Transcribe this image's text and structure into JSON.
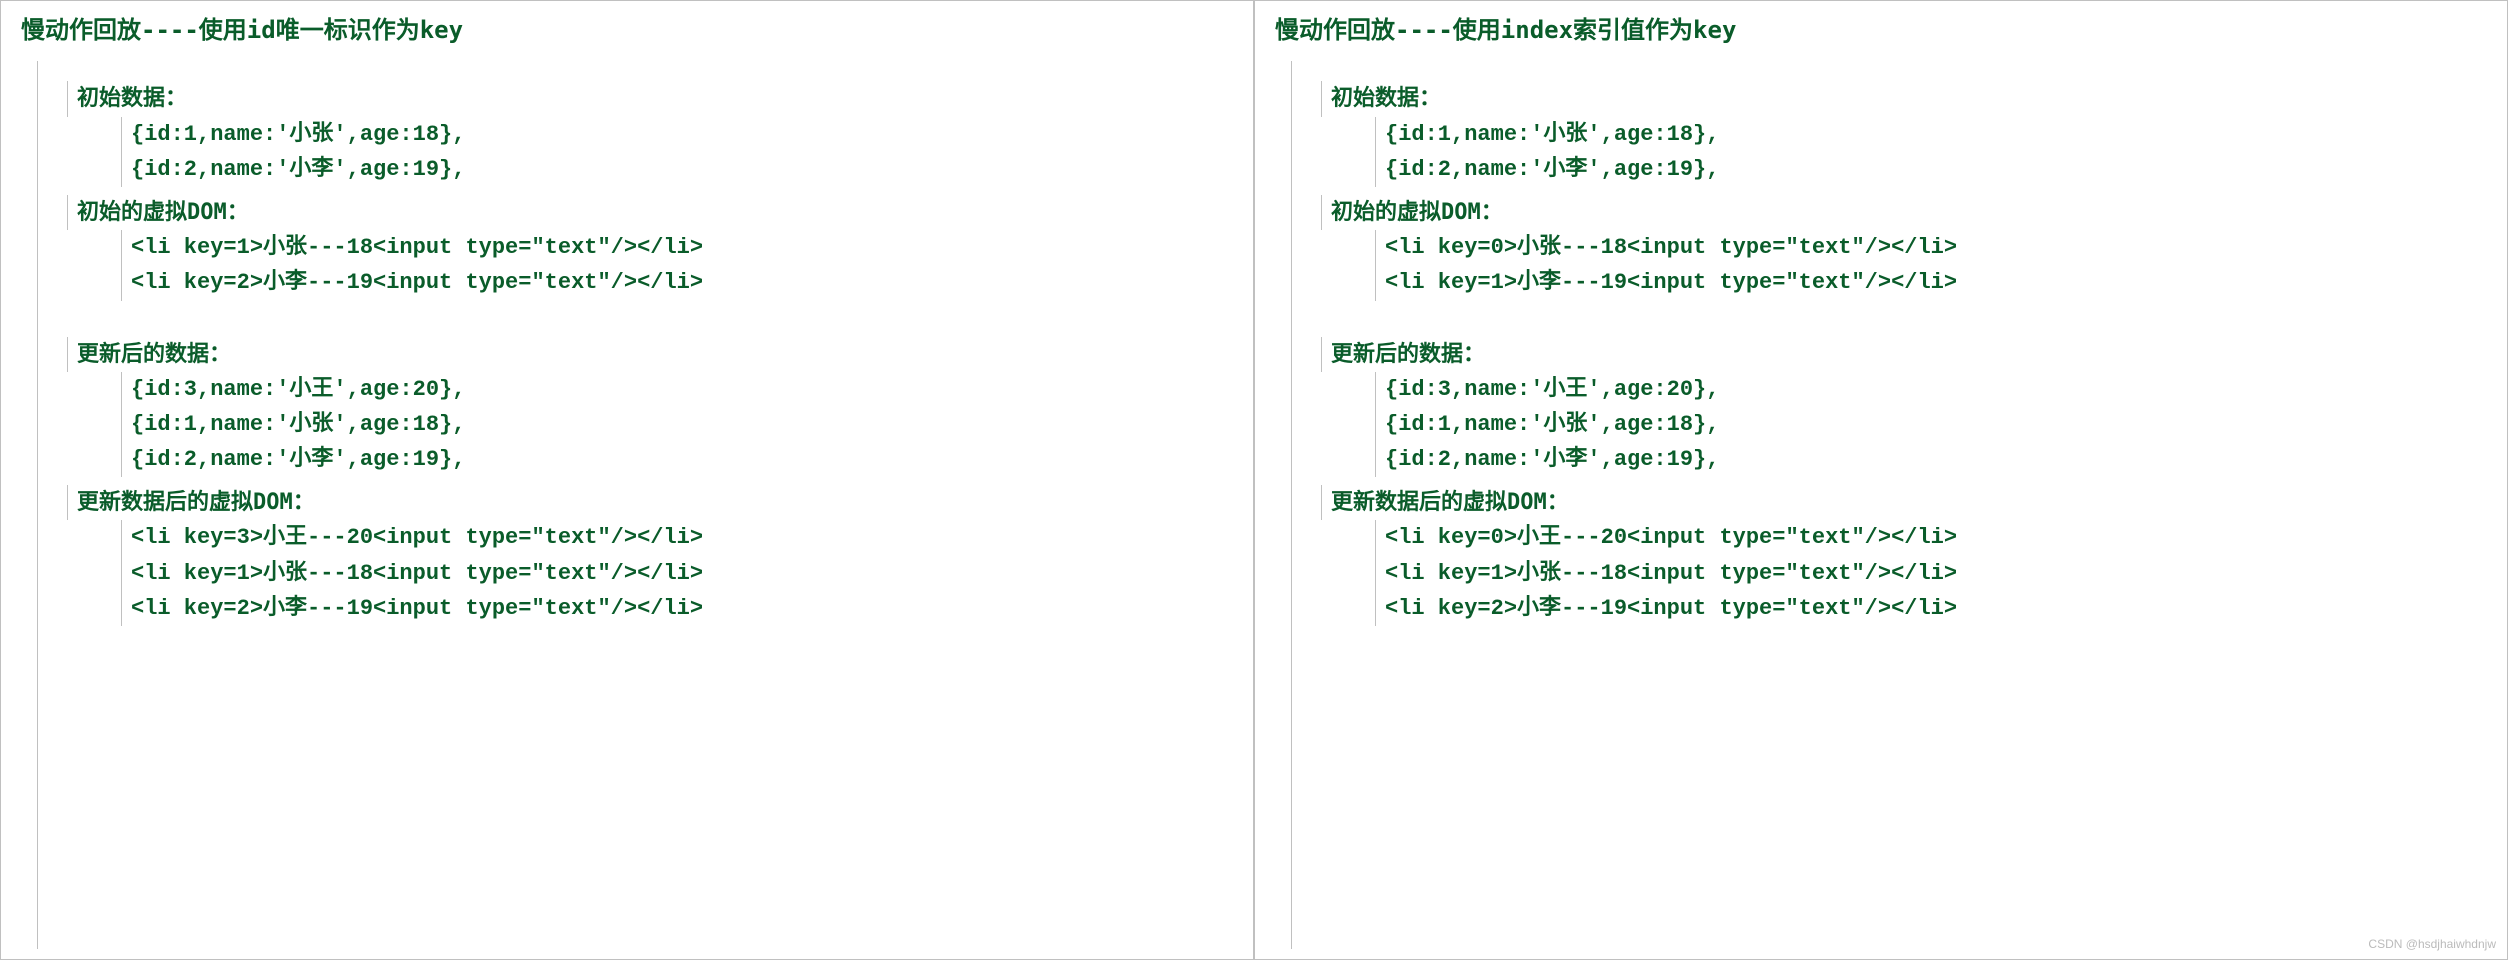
{
  "left": {
    "title": "慢动作回放----使用id唯一标识作为key",
    "sections": {
      "initialData": {
        "heading": "初始数据：",
        "lines": [
          "{id:1,name:'小张',age:18},",
          "{id:2,name:'小李',age:19},"
        ]
      },
      "initialVDom": {
        "heading": "初始的虚拟DOM：",
        "lines": [
          "<li key=1>小张---18<input type=\"text\"/></li>",
          "<li key=2>小李---19<input type=\"text\"/></li>"
        ]
      },
      "updatedData": {
        "heading": "更新后的数据：",
        "lines": [
          "{id:3,name:'小王',age:20},",
          "{id:1,name:'小张',age:18},",
          "{id:2,name:'小李',age:19},"
        ]
      },
      "updatedVDom": {
        "heading": "更新数据后的虚拟DOM：",
        "lines": [
          "<li key=3>小王---20<input type=\"text\"/></li>",
          "<li key=1>小张---18<input type=\"text\"/></li>",
          "<li key=2>小李---19<input type=\"text\"/></li>"
        ]
      }
    }
  },
  "right": {
    "title": "慢动作回放----使用index索引值作为key",
    "sections": {
      "initialData": {
        "heading": "初始数据：",
        "lines": [
          "{id:1,name:'小张',age:18},",
          "{id:2,name:'小李',age:19},"
        ]
      },
      "initialVDom": {
        "heading": "初始的虚拟DOM：",
        "lines": [
          "<li key=0>小张---18<input type=\"text\"/></li>",
          "<li key=1>小李---19<input type=\"text\"/></li>"
        ]
      },
      "updatedData": {
        "heading": "更新后的数据：",
        "lines": [
          "{id:3,name:'小王',age:20},",
          "{id:1,name:'小张',age:18},",
          "{id:2,name:'小李',age:19},"
        ]
      },
      "updatedVDom": {
        "heading": "更新数据后的虚拟DOM：",
        "lines": [
          "<li key=0>小王---20<input type=\"text\"/></li>",
          "<li key=1>小张---18<input type=\"text\"/></li>",
          "<li key=2>小李---19<input type=\"text\"/></li>"
        ]
      }
    }
  },
  "watermark": "CSDN @hsdjhaiwhdnjw"
}
